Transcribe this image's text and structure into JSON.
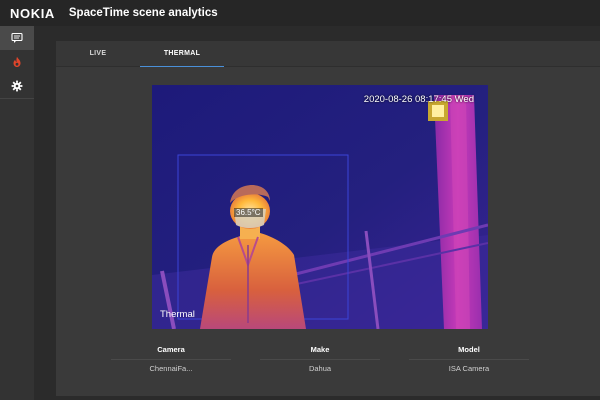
{
  "header": {
    "brand": "NOKIA",
    "title": "SpaceTime scene analytics"
  },
  "sidebar": {
    "items": [
      {
        "icon": "message-icon",
        "active": true
      },
      {
        "icon": "fire-icon",
        "active": false,
        "color": "#e0452b"
      },
      {
        "icon": "gear-icon",
        "active": false
      }
    ]
  },
  "tabs": [
    {
      "label": "LIVE",
      "active": false
    },
    {
      "label": "THERMAL",
      "active": true
    }
  ],
  "feed": {
    "timestamp": "2020-08-26 08:17:45 Wed",
    "temperature": "36.5°C",
    "mode_label": "Thermal"
  },
  "info": {
    "columns": [
      {
        "header": "Camera",
        "value": "ChennaiFa..."
      },
      {
        "header": "Make",
        "value": "Dahua"
      },
      {
        "header": "Model",
        "value": "ISA Camera"
      }
    ]
  },
  "colors": {
    "accent": "#4a90d9",
    "thermal_cold": "#1a1a78",
    "thermal_warm": "#c01fb4",
    "thermal_hot": "#ffb030"
  }
}
